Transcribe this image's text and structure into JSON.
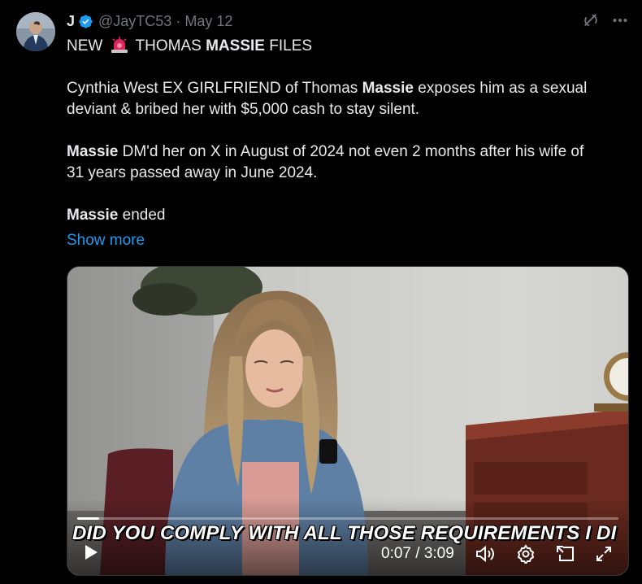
{
  "post": {
    "name": "J",
    "handle": "@JayTC53",
    "separator": "·",
    "date": "May 12",
    "headline_prefix": "NEW",
    "headline_mid": "THOMAS",
    "headline_bold": "MASSIE",
    "headline_suffix": "FILES",
    "p1_line1_a": "Cynthia West EX GIRLFRIEND of Thomas ",
    "p1_line1_bold": "Massie",
    "p1_line1_b": " exposes him as a sexual",
    "p1_line2": "deviant & bribed her with $5,000 cash to stay silent.",
    "p2_line1_bold": "Massie",
    "p2_line1_b": " DM'd her on X in August of 2024 not even 2 months after his wife of",
    "p2_line2": "31 years passed away in June 2024.",
    "p3_bold": "Massie",
    "p3_b": " ended",
    "show_more": "Show more"
  },
  "video": {
    "caption": "DID YOU COMPLY WITH ALL THOSE REQUIREMENTS I DI",
    "time": "0:07 / 3:09",
    "progress": 0.04
  },
  "icons": {
    "verified": "verified-badge-icon",
    "grok": "grok-icon",
    "more": "more-icon",
    "siren": "siren-emoji-icon",
    "play": "play-icon",
    "volume": "volume-icon",
    "settings": "settings-icon",
    "pip": "picture-in-picture-icon",
    "fullscreen": "fullscreen-icon"
  },
  "colors": {
    "background": "#000000",
    "text": "#e7e9ea",
    "muted": "#71767b",
    "link": "#1d9bf0",
    "verified": "#1d9bf0"
  }
}
